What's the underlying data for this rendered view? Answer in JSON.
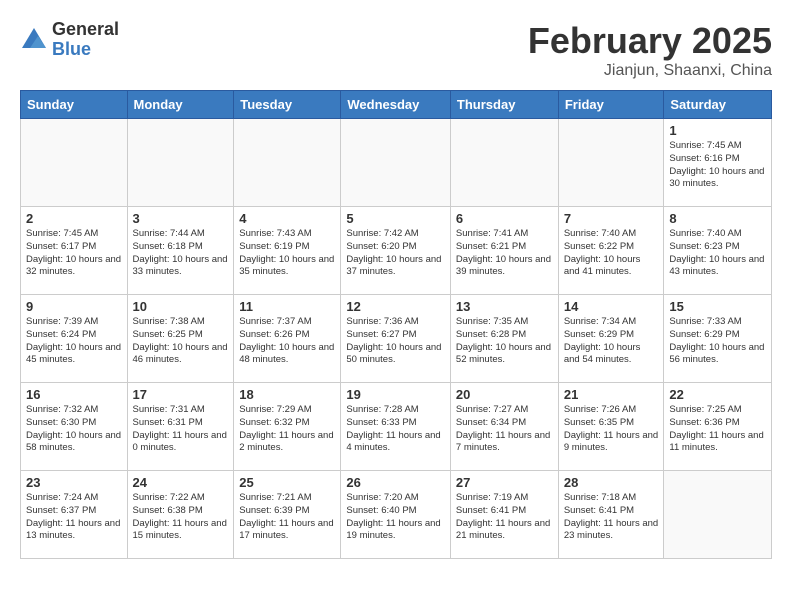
{
  "header": {
    "logo_general": "General",
    "logo_blue": "Blue",
    "month_title": "February 2025",
    "location": "Jianjun, Shaanxi, China"
  },
  "weekdays": [
    "Sunday",
    "Monday",
    "Tuesday",
    "Wednesday",
    "Thursday",
    "Friday",
    "Saturday"
  ],
  "weeks": [
    [
      {
        "day": "",
        "info": ""
      },
      {
        "day": "",
        "info": ""
      },
      {
        "day": "",
        "info": ""
      },
      {
        "day": "",
        "info": ""
      },
      {
        "day": "",
        "info": ""
      },
      {
        "day": "",
        "info": ""
      },
      {
        "day": "1",
        "info": "Sunrise: 7:45 AM\nSunset: 6:16 PM\nDaylight: 10 hours and 30 minutes."
      }
    ],
    [
      {
        "day": "2",
        "info": "Sunrise: 7:45 AM\nSunset: 6:17 PM\nDaylight: 10 hours and 32 minutes."
      },
      {
        "day": "3",
        "info": "Sunrise: 7:44 AM\nSunset: 6:18 PM\nDaylight: 10 hours and 33 minutes."
      },
      {
        "day": "4",
        "info": "Sunrise: 7:43 AM\nSunset: 6:19 PM\nDaylight: 10 hours and 35 minutes."
      },
      {
        "day": "5",
        "info": "Sunrise: 7:42 AM\nSunset: 6:20 PM\nDaylight: 10 hours and 37 minutes."
      },
      {
        "day": "6",
        "info": "Sunrise: 7:41 AM\nSunset: 6:21 PM\nDaylight: 10 hours and 39 minutes."
      },
      {
        "day": "7",
        "info": "Sunrise: 7:40 AM\nSunset: 6:22 PM\nDaylight: 10 hours and 41 minutes."
      },
      {
        "day": "8",
        "info": "Sunrise: 7:40 AM\nSunset: 6:23 PM\nDaylight: 10 hours and 43 minutes."
      }
    ],
    [
      {
        "day": "9",
        "info": "Sunrise: 7:39 AM\nSunset: 6:24 PM\nDaylight: 10 hours and 45 minutes."
      },
      {
        "day": "10",
        "info": "Sunrise: 7:38 AM\nSunset: 6:25 PM\nDaylight: 10 hours and 46 minutes."
      },
      {
        "day": "11",
        "info": "Sunrise: 7:37 AM\nSunset: 6:26 PM\nDaylight: 10 hours and 48 minutes."
      },
      {
        "day": "12",
        "info": "Sunrise: 7:36 AM\nSunset: 6:27 PM\nDaylight: 10 hours and 50 minutes."
      },
      {
        "day": "13",
        "info": "Sunrise: 7:35 AM\nSunset: 6:28 PM\nDaylight: 10 hours and 52 minutes."
      },
      {
        "day": "14",
        "info": "Sunrise: 7:34 AM\nSunset: 6:29 PM\nDaylight: 10 hours and 54 minutes."
      },
      {
        "day": "15",
        "info": "Sunrise: 7:33 AM\nSunset: 6:29 PM\nDaylight: 10 hours and 56 minutes."
      }
    ],
    [
      {
        "day": "16",
        "info": "Sunrise: 7:32 AM\nSunset: 6:30 PM\nDaylight: 10 hours and 58 minutes."
      },
      {
        "day": "17",
        "info": "Sunrise: 7:31 AM\nSunset: 6:31 PM\nDaylight: 11 hours and 0 minutes."
      },
      {
        "day": "18",
        "info": "Sunrise: 7:29 AM\nSunset: 6:32 PM\nDaylight: 11 hours and 2 minutes."
      },
      {
        "day": "19",
        "info": "Sunrise: 7:28 AM\nSunset: 6:33 PM\nDaylight: 11 hours and 4 minutes."
      },
      {
        "day": "20",
        "info": "Sunrise: 7:27 AM\nSunset: 6:34 PM\nDaylight: 11 hours and 7 minutes."
      },
      {
        "day": "21",
        "info": "Sunrise: 7:26 AM\nSunset: 6:35 PM\nDaylight: 11 hours and 9 minutes."
      },
      {
        "day": "22",
        "info": "Sunrise: 7:25 AM\nSunset: 6:36 PM\nDaylight: 11 hours and 11 minutes."
      }
    ],
    [
      {
        "day": "23",
        "info": "Sunrise: 7:24 AM\nSunset: 6:37 PM\nDaylight: 11 hours and 13 minutes."
      },
      {
        "day": "24",
        "info": "Sunrise: 7:22 AM\nSunset: 6:38 PM\nDaylight: 11 hours and 15 minutes."
      },
      {
        "day": "25",
        "info": "Sunrise: 7:21 AM\nSunset: 6:39 PM\nDaylight: 11 hours and 17 minutes."
      },
      {
        "day": "26",
        "info": "Sunrise: 7:20 AM\nSunset: 6:40 PM\nDaylight: 11 hours and 19 minutes."
      },
      {
        "day": "27",
        "info": "Sunrise: 7:19 AM\nSunset: 6:41 PM\nDaylight: 11 hours and 21 minutes."
      },
      {
        "day": "28",
        "info": "Sunrise: 7:18 AM\nSunset: 6:41 PM\nDaylight: 11 hours and 23 minutes."
      },
      {
        "day": "",
        "info": ""
      }
    ]
  ]
}
